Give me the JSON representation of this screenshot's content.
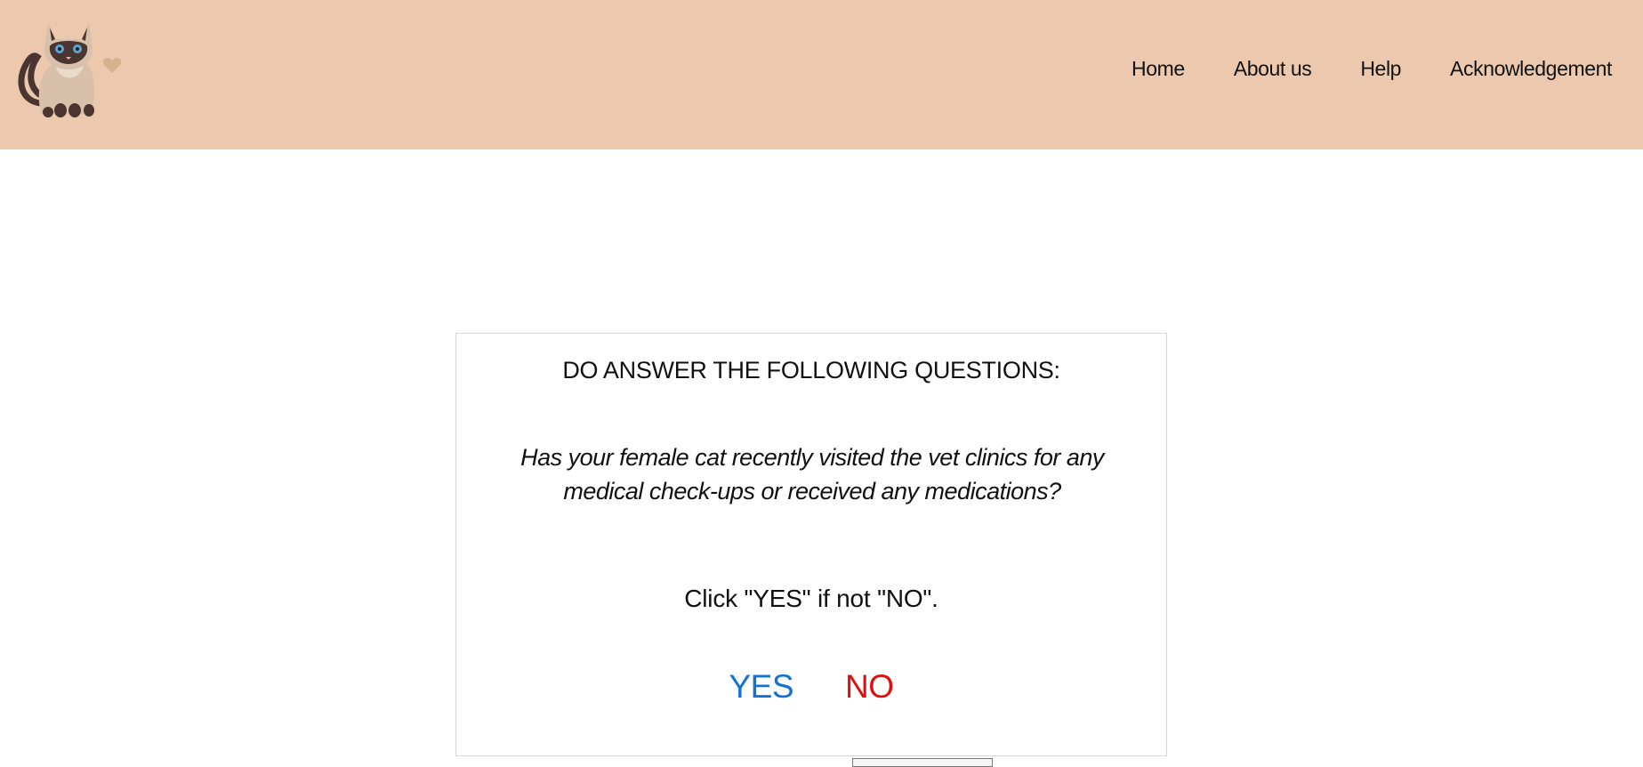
{
  "header": {
    "logo_icon": "siamese-cat-with-heart-icon",
    "nav": [
      {
        "label": "Home"
      },
      {
        "label": "About us"
      },
      {
        "label": "Help"
      },
      {
        "label": "Acknowledgement"
      }
    ]
  },
  "card": {
    "title": "DO ANSWER THE FOLLOWING QUESTIONS:",
    "question": "Has your female cat recently visited the vet clinics for any medical check-ups or received any medications?",
    "instruction": "Click \"YES\" if not \"NO\".",
    "yes_label": "YES",
    "no_label": "NO"
  },
  "colors": {
    "header_bg": "#ecc8ae",
    "yes": "#1272d4",
    "no": "#e10f0f"
  }
}
